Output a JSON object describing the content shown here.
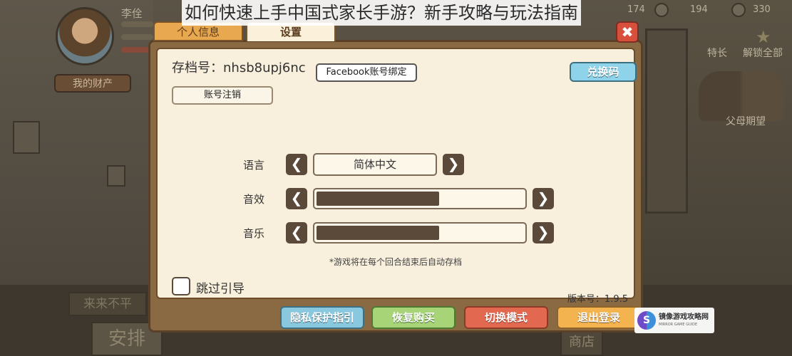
{
  "article_title": "如何快速上手中国式家长手游？新手攻略与玩法指南",
  "background": {
    "player_name": "李佺",
    "bag_button": "我的财产",
    "stats": [
      "174",
      "194",
      "330"
    ],
    "side_labels": {
      "specialty": "特长",
      "unlock_all": "解锁全部",
      "parent_expect": "父母期望"
    },
    "hint_board": "来来不平",
    "arrange_button": "安排",
    "shop_button": "商店"
  },
  "dialog": {
    "tabs": {
      "personal": "个人信息",
      "settings": "设置"
    },
    "close_glyph": "✖",
    "save_id": "存档号：nhsb8upj6nc",
    "facebook_bind": "Facebook账号绑定",
    "account_cancel": "账号注销",
    "redeem_code": "兑换码",
    "language": {
      "label": "语言",
      "value": "简体中文"
    },
    "sound_effect": {
      "label": "音效",
      "level": 0.6
    },
    "music": {
      "label": "音乐",
      "level": 0.6
    },
    "arrows": {
      "left": "❮",
      "right": "❯"
    },
    "auto_save_note": "*游戏将在每个回合结束后自动存档",
    "skip_guide": "跳过引导",
    "version": "版本号：1.9.5",
    "buttons": {
      "privacy": "隐私保护指引",
      "restore": "恢复购买",
      "switch_mode": "切换模式",
      "logout": "退出登录"
    }
  },
  "watermark": {
    "logo": "S",
    "name": "镜像游戏攻略网",
    "sub": "MIRROR GAME GUIDE"
  }
}
